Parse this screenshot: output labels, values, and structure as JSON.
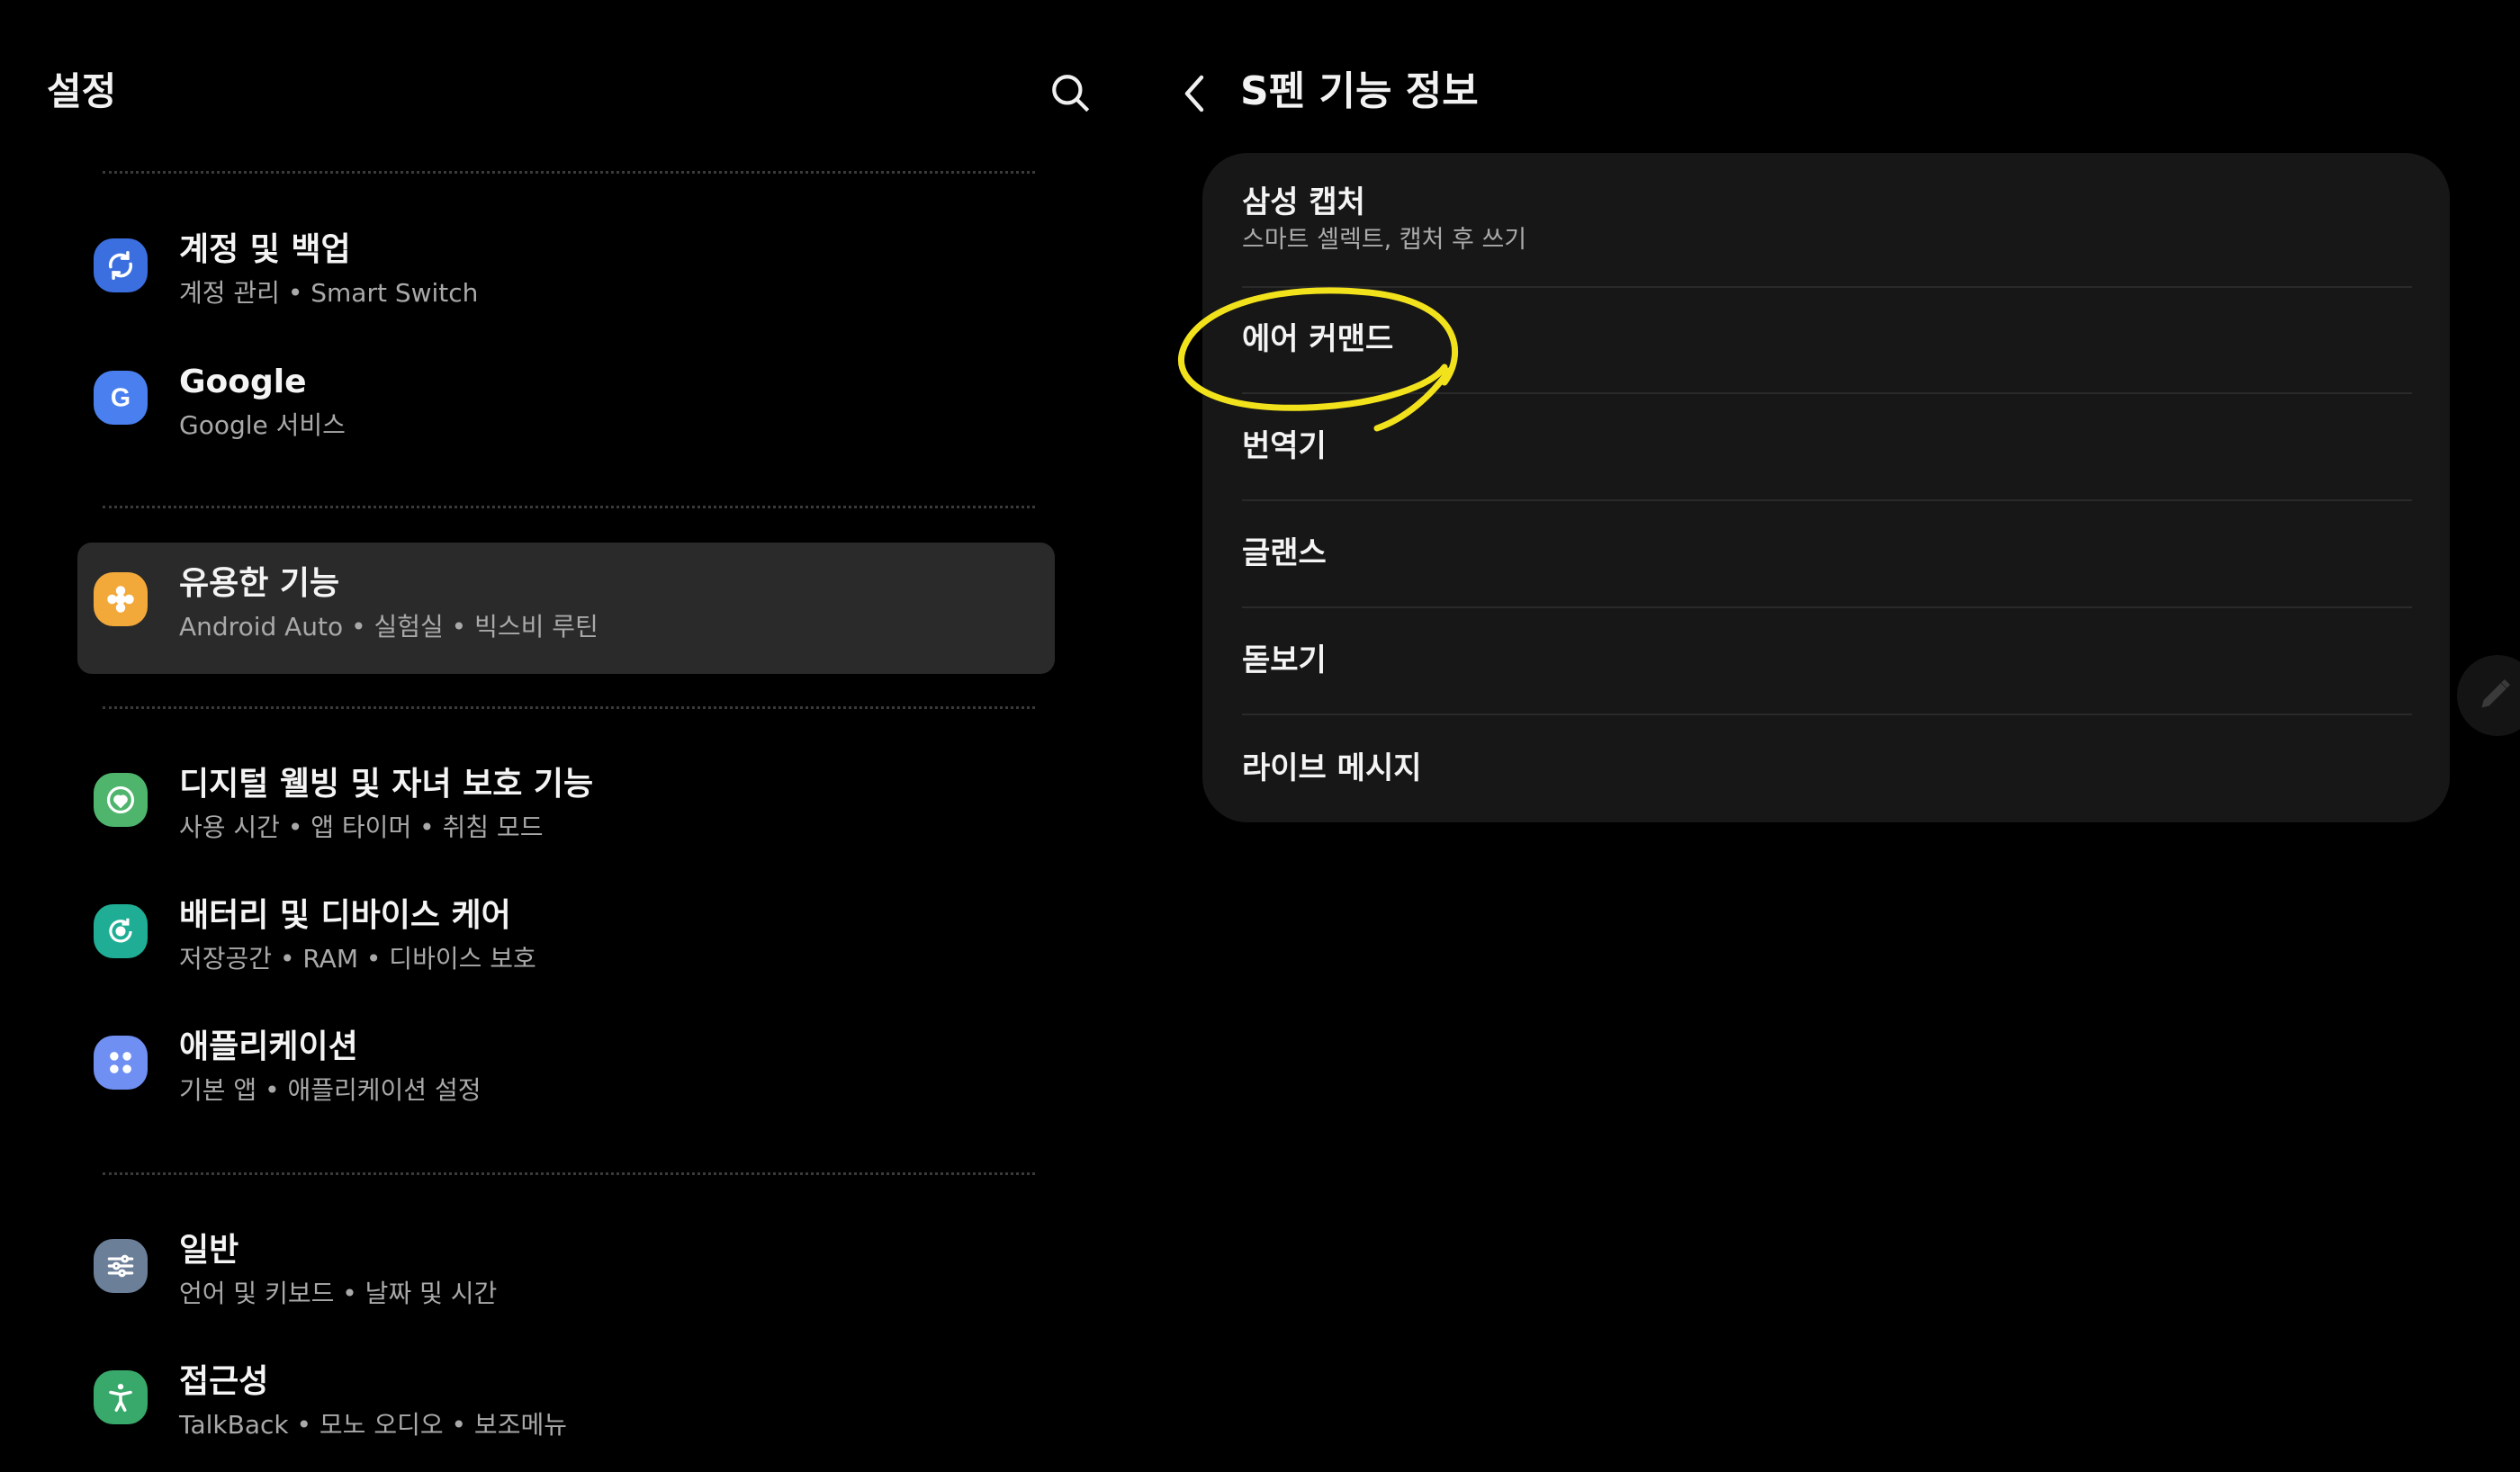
{
  "left_panel": {
    "title": "설정",
    "items": [
      {
        "title": "계정 및 백업",
        "subtitle": "계정 관리 • Smart Switch",
        "icon": "sync-icon",
        "color": "#3b6fe0"
      },
      {
        "title": "Google",
        "subtitle": "Google 서비스",
        "icon": "google-icon",
        "color": "#4a7ff0"
      },
      {
        "title": "유용한 기능",
        "subtitle": "Android Auto • 실험실 • 빅스비 루틴",
        "icon": "puzzle-icon",
        "color": "#f2a93a",
        "selected": true
      },
      {
        "title": "디지털 웰빙 및 자녀 보호 기능",
        "subtitle": "사용 시간 • 앱 타이머 • 취침 모드",
        "icon": "wellbeing-icon",
        "color": "#4fb56d"
      },
      {
        "title": "배터리 및 디바이스 케어",
        "subtitle": "저장공간 • RAM • 디바이스 보호",
        "icon": "device-care-icon",
        "color": "#1fae95"
      },
      {
        "title": "애플리케이션",
        "subtitle": "기본 앱 • 애플리케이션 설정",
        "icon": "apps-icon",
        "color": "#6f8ff2"
      },
      {
        "title": "일반",
        "subtitle": "언어 및 키보드 • 날짜 및 시간",
        "icon": "sliders-icon",
        "color": "#6b7f98"
      },
      {
        "title": "접근성",
        "subtitle": "TalkBack • 모노 오디오 • 보조메뉴",
        "icon": "accessibility-icon",
        "color": "#38a96a"
      }
    ]
  },
  "right_panel": {
    "title": "S펜 기능 정보",
    "rows": [
      {
        "title": "삼성 캡처",
        "subtitle": "스마트 셀렉트, 캡처 후 쓰기"
      },
      {
        "title": "에어 커맨드"
      },
      {
        "title": "번역기"
      },
      {
        "title": "글랜스"
      },
      {
        "title": "돋보기"
      },
      {
        "title": "라이브 메시지"
      }
    ]
  },
  "colors": {
    "background": "#000000",
    "card": "#171717",
    "selected_item": "#2a2a2a",
    "annotation": "#f2e21c"
  }
}
